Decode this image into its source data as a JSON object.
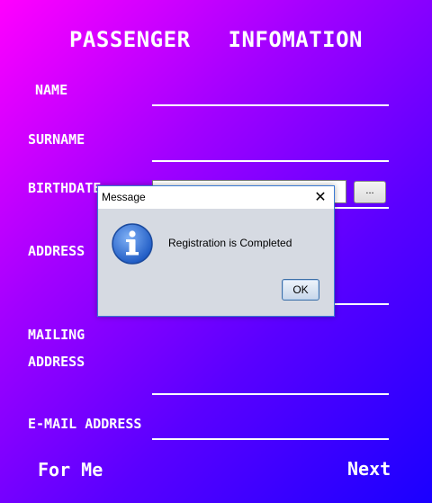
{
  "header": {
    "title_part1": "PASSENGER",
    "title_part2": "INFOMATION"
  },
  "form": {
    "name_label": "NAME",
    "surname_label": "SURNAME",
    "birthdate_label": "BIRTHDATE",
    "birthdate_button": "...",
    "address_label": "ADDRESS",
    "mailing_label_line1": "MAILING",
    "mailing_label_line2": "ADDRESS",
    "email_label": "E-MAIL ADDRESS"
  },
  "footer": {
    "left_button": "For Me",
    "right_button": "Next"
  },
  "dialog": {
    "title": "Message",
    "close_glyph": "✕",
    "icon": "info-icon",
    "message": "Registration is Completed",
    "ok_label": "OK"
  },
  "colors": {
    "gradient_start": "#ff00ff",
    "gradient_end": "#1a00ff",
    "text": "#ffffff",
    "dialog_bg": "#d6dae2",
    "info_blue": "#2f6bd0"
  }
}
